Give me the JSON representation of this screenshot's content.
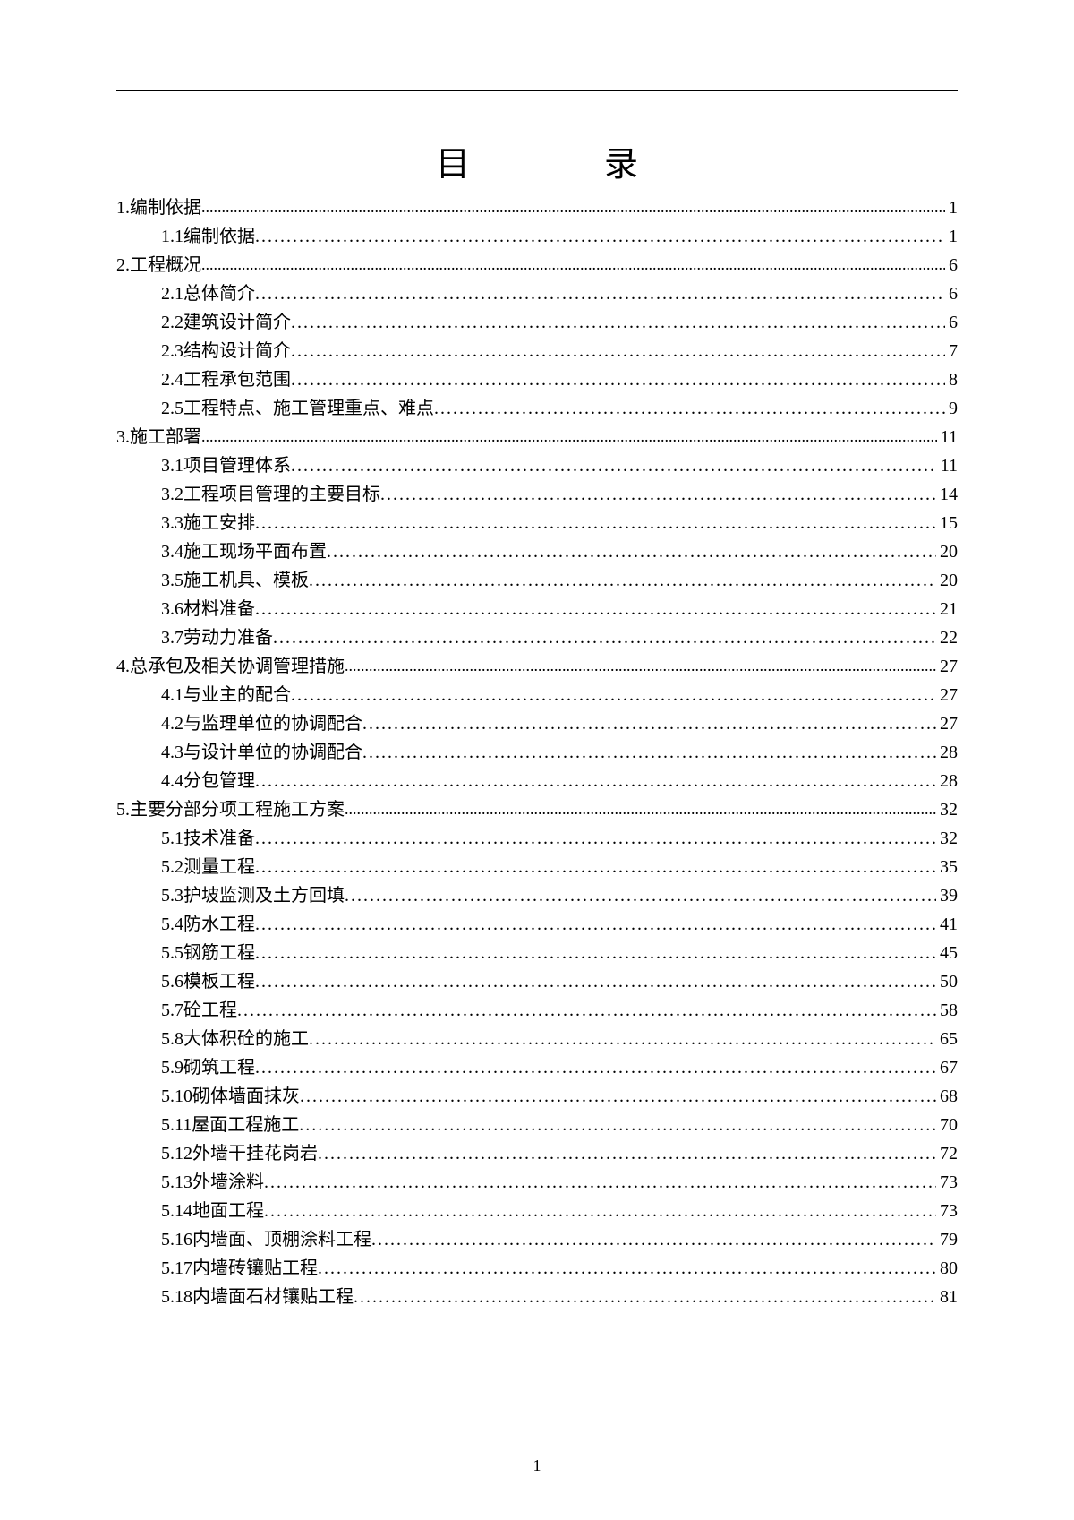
{
  "title": "目录",
  "pageNumber": "1",
  "toc": [
    {
      "level": 1,
      "label": "1.编制依据",
      "page": "1"
    },
    {
      "level": 2,
      "label": "1.1编制依据",
      "page": "1"
    },
    {
      "level": 1,
      "label": "2.工程概况",
      "page": "6"
    },
    {
      "level": 2,
      "label": "2.1总体简介",
      "page": "6"
    },
    {
      "level": 2,
      "label": "2.2建筑设计简介",
      "page": "6"
    },
    {
      "level": 2,
      "label": "2.3结构设计简介",
      "page": "7"
    },
    {
      "level": 2,
      "label": "2.4工程承包范围",
      "page": "8"
    },
    {
      "level": 2,
      "label": "2.5工程特点、施工管理重点、难点",
      "page": "9"
    },
    {
      "level": 1,
      "label": "3.施工部署",
      "page": "11"
    },
    {
      "level": 2,
      "label": "3.1项目管理体系",
      "page": "11"
    },
    {
      "level": 2,
      "label": "3.2工程项目管理的主要目标",
      "page": "14"
    },
    {
      "level": 2,
      "label": "3.3施工安排",
      "page": "15"
    },
    {
      "level": 2,
      "label": "3.4施工现场平面布置",
      "page": "20"
    },
    {
      "level": 2,
      "label": "3.5施工机具、模板",
      "page": "20"
    },
    {
      "level": 2,
      "label": "3.6材料准备",
      "page": "21"
    },
    {
      "level": 2,
      "label": "3.7劳动力准备",
      "page": "22"
    },
    {
      "level": 1,
      "label": "4.总承包及相关协调管理措施",
      "page": "27"
    },
    {
      "level": 2,
      "label": "4.1与业主的配合",
      "page": "27"
    },
    {
      "level": 2,
      "label": "4.2与监理单位的协调配合",
      "page": "27"
    },
    {
      "level": 2,
      "label": "4.3与设计单位的协调配合",
      "page": "28"
    },
    {
      "level": 2,
      "label": "4.4分包管理",
      "page": "28"
    },
    {
      "level": 1,
      "label": "5.主要分部分项工程施工方案",
      "page": "32"
    },
    {
      "level": 2,
      "label": "5.1技术准备",
      "page": "32"
    },
    {
      "level": 2,
      "label": "5.2测量工程",
      "page": "35"
    },
    {
      "level": 2,
      "label": "5.3护坡监测及土方回填",
      "page": "39"
    },
    {
      "level": 2,
      "label": "5.4防水工程",
      "page": "41"
    },
    {
      "level": 2,
      "label": "5.5钢筋工程",
      "page": "45"
    },
    {
      "level": 2,
      "label": "5.6模板工程",
      "page": "50"
    },
    {
      "level": 2,
      "label": "5.7砼工程",
      "page": "58"
    },
    {
      "level": 2,
      "label": "5.8大体积砼的施工",
      "page": "65"
    },
    {
      "level": 2,
      "label": "5.9砌筑工程",
      "page": "67"
    },
    {
      "level": 2,
      "label": "5.10砌体墙面抹灰",
      "page": "68"
    },
    {
      "level": 2,
      "label": "5.11屋面工程施工",
      "page": "70"
    },
    {
      "level": 2,
      "label": "5.12外墙干挂花岗岩",
      "page": "72"
    },
    {
      "level": 2,
      "label": "5.13外墙涂料",
      "page": "73"
    },
    {
      "level": 2,
      "label": "5.14地面工程",
      "page": "73"
    },
    {
      "level": 2,
      "label": "5.16内墙面、顶棚涂料工程",
      "page": "79"
    },
    {
      "level": 2,
      "label": "5.17内墙砖镶贴工程",
      "page": "80"
    },
    {
      "level": 2,
      "label": "5.18内墙面石材镶贴工程",
      "page": "81"
    }
  ]
}
